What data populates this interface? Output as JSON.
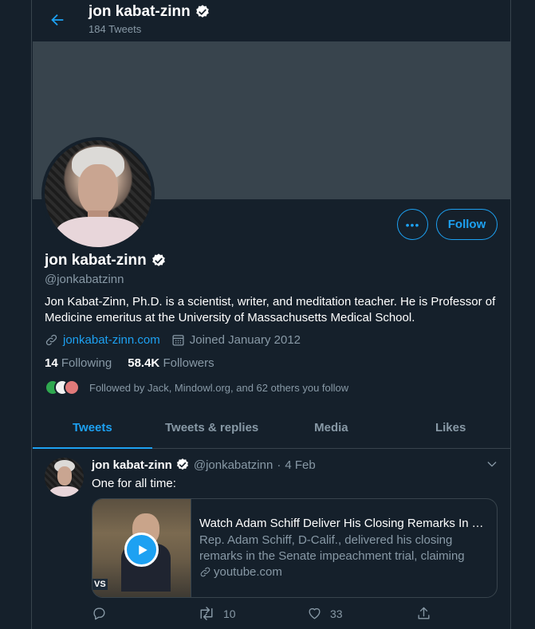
{
  "header": {
    "name": "jon kabat-zinn",
    "tweet_count": "184 Tweets"
  },
  "profile": {
    "name": "jon kabat-zinn",
    "handle": "@jonkabatzinn",
    "bio": "Jon Kabat-Zinn, Ph.D. is a scientist, writer, and meditation teacher. He is Professor of Medicine emeritus at the University of Massachusetts Medical School.",
    "website": "jonkabat-zinn.com",
    "joined": "Joined January 2012",
    "following_count": "14",
    "following_label": "Following",
    "followers_count": "58.4K",
    "followers_label": "Followers",
    "followed_by": "Followed by Jack, Mindowl.org, and 62 others you follow",
    "follow_label": "Follow",
    "more_label": "•••"
  },
  "tabs": [
    {
      "label": "Tweets",
      "active": true
    },
    {
      "label": "Tweets & replies",
      "active": false
    },
    {
      "label": "Media",
      "active": false
    },
    {
      "label": "Likes",
      "active": false
    }
  ],
  "tweet": {
    "name": "jon kabat-zinn",
    "handle": "@jonkabatzinn",
    "separator": "·",
    "date": "4 Feb",
    "text": "One for all time:",
    "card": {
      "title": "Watch Adam Schiff Deliver His Closing Remarks In Th...",
      "description": "Rep. Adam Schiff, D-Calif., delivered his closing remarks in the Senate impeachment trial, claiming how ...",
      "domain": "youtube.com",
      "thumb_badge": "VS"
    },
    "retweets": "10",
    "likes": "33"
  },
  "colors": {
    "background": "#15202b",
    "accent": "#1da1f2",
    "muted": "#8899a6",
    "border": "#38444d"
  }
}
